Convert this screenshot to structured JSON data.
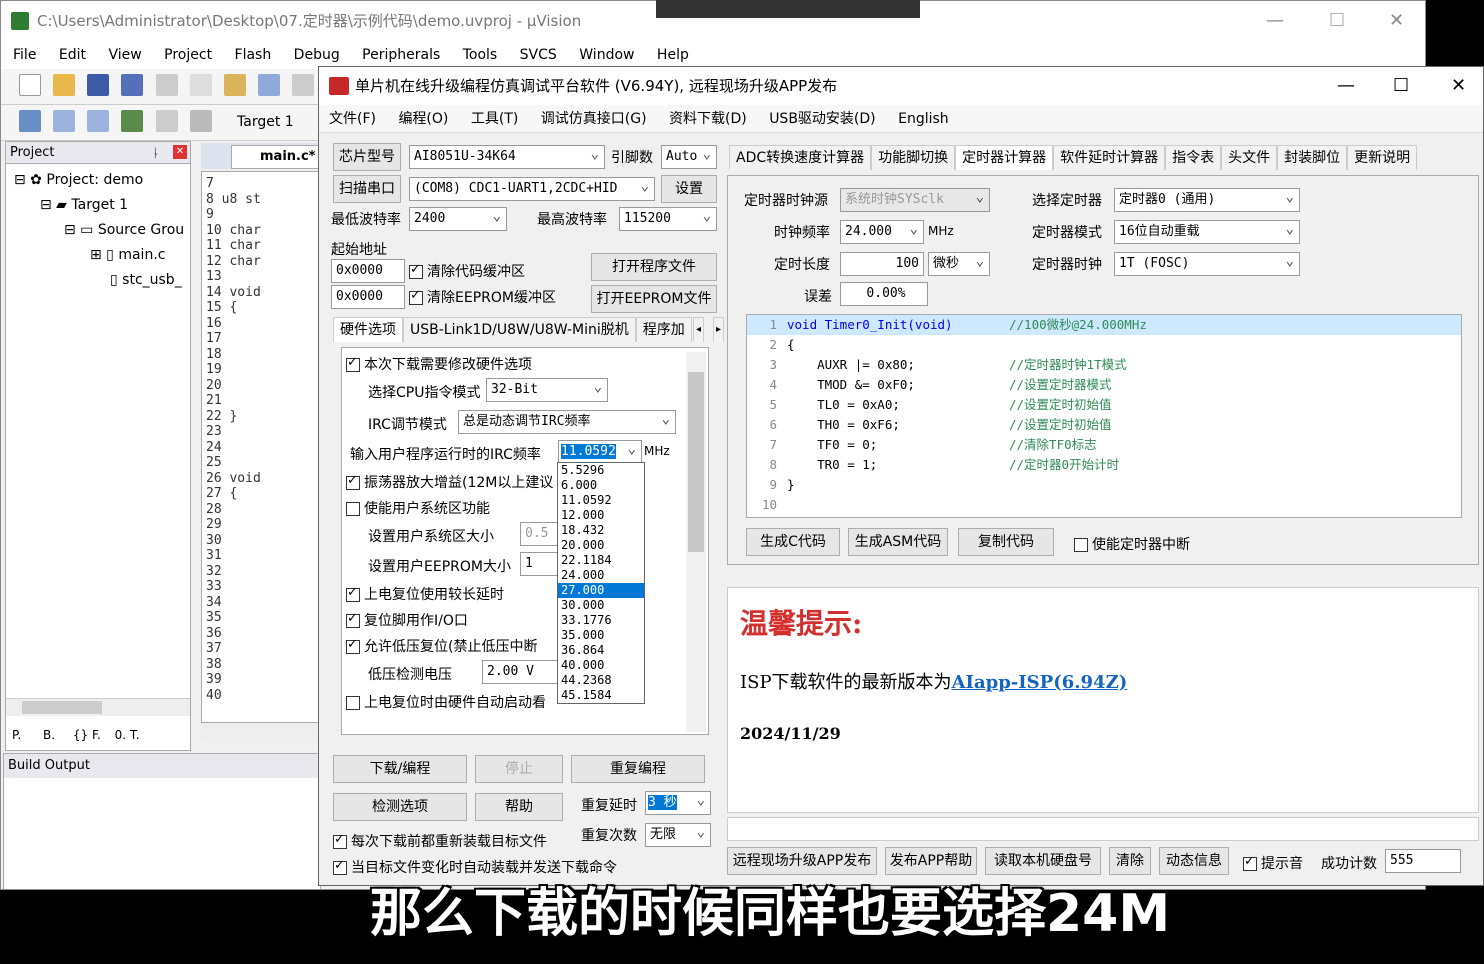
{
  "uvision": {
    "title": "C:\\Users\\Administrator\\Desktop\\07.定时器\\示例代码\\demo.uvproj - µVision",
    "menu": [
      "File",
      "Edit",
      "View",
      "Project",
      "Flash",
      "Debug",
      "Peripherals",
      "Tools",
      "SVCS",
      "Window",
      "Help"
    ],
    "target": "Target 1",
    "project_header": "Project",
    "tree": [
      "Project: demo",
      "Target 1",
      "Source Grou",
      "main.c",
      "stc_usb_"
    ],
    "tab": "main.c*",
    "lines": [
      "7",
      "8 u8 st",
      "9",
      "10 char",
      "11 char",
      "12 char",
      "13",
      "14 void",
      "15 {",
      "16",
      "17",
      "18",
      "19",
      "20",
      "21",
      "22 }",
      "23",
      "24",
      "25",
      "26 void",
      "27 {",
      "28",
      "29",
      "30",
      "31",
      "32",
      "33",
      "34",
      "35",
      "36",
      "37",
      "38",
      "39",
      "40"
    ],
    "bottom_tabs": [
      "P.",
      "B.",
      "{} F.",
      "0. T."
    ],
    "build_output": "Build Output"
  },
  "isp": {
    "title": "单片机在线升级编程仿真调试平台软件 (V6.94Y), 远程现场升级APP发布",
    "menu": [
      "文件(F)",
      "编程(O)",
      "工具(T)",
      "调试仿真接口(G)",
      "资料下载(D)",
      "USB驱动安装(D)",
      "English"
    ],
    "chip_label": "芯片型号",
    "chip_value": "AI8051U-34K64",
    "pin_label": "引脚数",
    "pin_value": "Auto",
    "scan_btn": "扫描串口",
    "port_value": "(COM8) CDC1-UART1,2CDC+HID",
    "settings_btn": "设置",
    "min_baud_label": "最低波特率",
    "min_baud": "2400",
    "max_baud_label": "最高波特率",
    "max_baud": "115200",
    "start_addr_label": "起始地址",
    "addr1": "0x0000",
    "addr2": "0x0000",
    "clear_code": "清除代码缓冲区",
    "clear_eeprom": "清除EEPROM缓冲区",
    "open_prog": "打开程序文件",
    "open_eeprom": "打开EEPROM文件",
    "tabs": [
      "硬件选项",
      "USB-Link1D/U8W/U8W-Mini脱机",
      "程序加"
    ],
    "hw": {
      "modify": "本次下载需要修改硬件选项",
      "cpu_mode_label": "选择CPU指令模式",
      "cpu_mode": "32-Bit",
      "irc_mode_label": "IRC调节模式",
      "irc_mode": "总是动态调节IRC频率",
      "irc_freq_label": "输入用户程序运行时的IRC频率",
      "irc_freq": "11.0592",
      "mhz": "MHz",
      "osc_gain": "振荡器放大增益(12M以上建议",
      "user_sys": "使能用户系统区功能",
      "sys_size_label": "设置用户系统区大小",
      "sys_size": "0.5",
      "eeprom_size_label": "设置用户EEPROM大小",
      "eeprom_size": "1",
      "long_delay": "上电复位使用较长延时",
      "reset_io": "复位脚用作I/O口",
      "lvd_reset": "允许低压复位(禁止低压中断",
      "lvd_label": "低压检测电压",
      "lvd_value": "2.00 V",
      "auto_start": "上电复位时由硬件自动启动看"
    },
    "freq_options": [
      "5.5296",
      "6.000",
      "11.0592",
      "12.000",
      "18.432",
      "20.000",
      "22.1184",
      "24.000",
      "27.000",
      "30.000",
      "33.1776",
      "35.000",
      "36.864",
      "40.000",
      "44.2368",
      "45.1584"
    ],
    "freq_selected": "27.000",
    "download_btn": "下载/编程",
    "stop_btn": "停止",
    "reprogram_btn": "重复编程",
    "check_btn": "检测选项",
    "help_btn": "帮助",
    "repeat_delay_label": "重复延时",
    "repeat_delay": "3 秒",
    "repeat_count_label": "重复次数",
    "repeat_count": "无限",
    "reload_each": "每次下载前都重新装载目标文件",
    "auto_reload": "当目标文件变化时自动装载并发送下载命令",
    "right_tabs": [
      "ADC转换速度计算器",
      "功能脚切换",
      "定时器计算器",
      "软件延时计算器",
      "指令表",
      "头文件",
      "封装脚位",
      "更新说明"
    ],
    "timer": {
      "clk_src_label": "定时器时钟源",
      "clk_src": "系统时钟SYSclk",
      "select_label": "选择定时器",
      "select": "定时器0 (通用)",
      "freq_label": "时钟频率",
      "freq": "24.000",
      "mhz": "MHz",
      "mode_label": "定时器模式",
      "mode": "16位自动重载",
      "len_label": "定时长度",
      "len": "100",
      "unit": "微秒",
      "tclk_label": "定时器时钟",
      "tclk": "1T  (FOSC)",
      "err_label": "误差",
      "err": "0.00%",
      "gen_c": "生成C代码",
      "gen_asm": "生成ASM代码",
      "copy": "复制代码",
      "enable_int": "使能定时器中断"
    },
    "code_lines": [
      {
        "n": "1",
        "code": "void Timer0_Init(void)",
        "cmt": "//100微秒@24.000MHz"
      },
      {
        "n": "2",
        "code": "{",
        "cmt": ""
      },
      {
        "n": "3",
        "code": "    AUXR |= 0x80;",
        "cmt": "//定时器时钟1T模式"
      },
      {
        "n": "4",
        "code": "    TMOD &= 0xF0;",
        "cmt": "//设置定时器模式"
      },
      {
        "n": "5",
        "code": "    TL0 = 0xA0;",
        "cmt": "//设置定时初始值"
      },
      {
        "n": "6",
        "code": "    TH0 = 0xF6;",
        "cmt": "//设置定时初始值"
      },
      {
        "n": "7",
        "code": "    TF0 = 0;",
        "cmt": "//清除TF0标志"
      },
      {
        "n": "8",
        "code": "    TR0 = 1;",
        "cmt": "//定时器0开始计时"
      },
      {
        "n": "9",
        "code": "}",
        "cmt": ""
      },
      {
        "n": "10",
        "code": "",
        "cmt": ""
      }
    ],
    "tip_title": "温馨提示:",
    "tip_text": "ISP下载软件的最新版本为",
    "tip_link": "AIapp-ISP(6.94Z)",
    "tip_date": "2024/11/29",
    "bottom_btns": [
      "远程现场升级APP发布",
      "发布APP帮助",
      "读取本机硬盘号",
      "清除",
      "动态信息"
    ],
    "beep": "提示音",
    "success_label": "成功计数",
    "success_count": "555"
  },
  "subtitle": "那么下载的时候同样也要选择24M"
}
